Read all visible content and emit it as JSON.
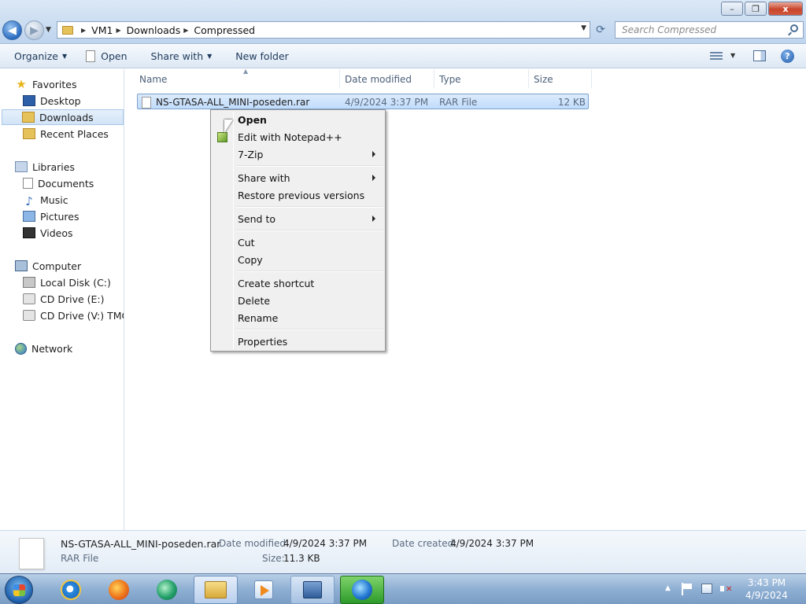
{
  "window": {
    "minimize_glyph": "–",
    "restore_glyph": "❐",
    "close_glyph": "x"
  },
  "address": {
    "crumbs": [
      "VM1",
      "Downloads",
      "Compressed"
    ],
    "search_placeholder": "Search Compressed"
  },
  "toolbar": {
    "organize": "Organize",
    "open": "Open",
    "share_with": "Share with",
    "new_folder": "New folder",
    "help_glyph": "?"
  },
  "nav": {
    "favorites": "Favorites",
    "desktop": "Desktop",
    "downloads": "Downloads",
    "recent_places": "Recent Places",
    "libraries": "Libraries",
    "documents": "Documents",
    "music": "Music",
    "pictures": "Pictures",
    "videos": "Videos",
    "computer": "Computer",
    "local_disk": "Local Disk (C:)",
    "cd_drive_e": "CD Drive (E:)",
    "cd_drive_v": "CD Drive (V:) TMORI",
    "network": "Network"
  },
  "columns": {
    "name": "Name",
    "date_modified": "Date modified",
    "type": "Type",
    "size": "Size"
  },
  "file": {
    "name": "NS-GTASA-ALL_MINI-poseden.rar",
    "date_modified": "4/9/2024 3:37 PM",
    "type": "RAR File",
    "size": "12 KB"
  },
  "context_menu": {
    "open": "Open",
    "edit_notepad": "Edit with Notepad++",
    "seven_zip": "7-Zip",
    "share_with": "Share with",
    "restore_versions": "Restore previous versions",
    "send_to": "Send to",
    "cut": "Cut",
    "copy": "Copy",
    "create_shortcut": "Create shortcut",
    "delete": "Delete",
    "rename": "Rename",
    "properties": "Properties"
  },
  "details": {
    "filename": "NS-GTASA-ALL_MINI-poseden.rar",
    "type": "RAR File",
    "date_modified_label": "Date modified:",
    "date_modified_value": "4/9/2024 3:37 PM",
    "date_created_label": "Date created:",
    "date_created_value": "4/9/2024 3:37 PM",
    "size_label": "Size:",
    "size_value": "11.3 KB"
  },
  "taskbar": {
    "time": "3:43 PM",
    "date": "4/9/2024"
  }
}
